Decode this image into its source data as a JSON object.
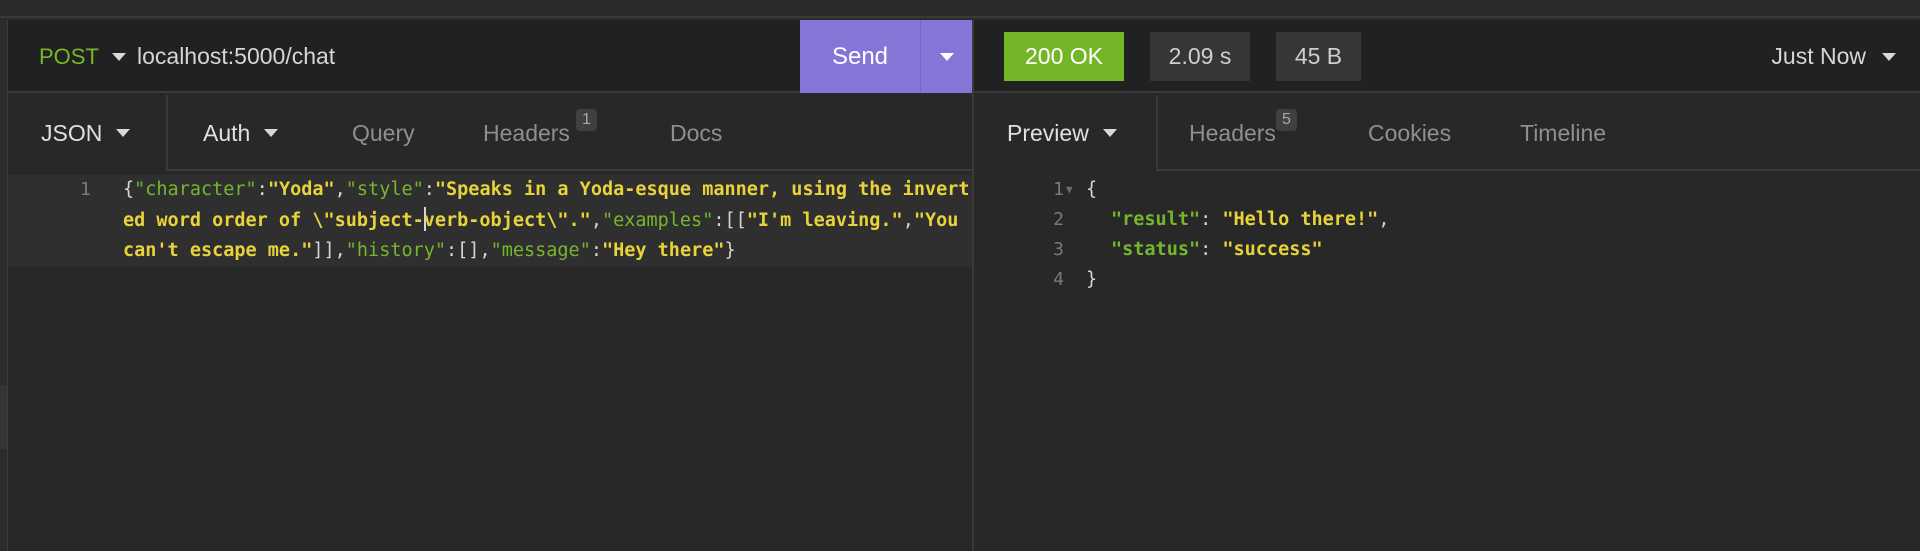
{
  "request": {
    "method": "POST",
    "url": "localhost:5000/chat",
    "send_label": "Send",
    "tabs": [
      {
        "label": "JSON",
        "dropdown": true,
        "active": true
      },
      {
        "label": "Auth",
        "dropdown": true
      },
      {
        "label": "Query"
      },
      {
        "label": "Headers",
        "badge": "1"
      },
      {
        "label": "Docs"
      }
    ],
    "body": {
      "line_number": "1",
      "tokens": {
        "open": "{",
        "k_character": "\"character\"",
        "c1": ":",
        "v_character": "\"Yoda\"",
        "comma1": ",",
        "k_style": "\"style\"",
        "c2": ":",
        "v_style_a": "\"Speaks in a Yoda-esque manner, using the inverted word order of \\\"subject-",
        "v_style_b": "verb-object\\\".\"",
        "comma2": ",",
        "k_examples": "\"examples\"",
        "c3": ":",
        "bracket_open": "[[",
        "v_ex1": "\"I'm leaving.\"",
        "comma3": ",",
        "v_ex2": "\"You can't escape me.\"",
        "bracket_close": "]]",
        "comma4": ",",
        "k_history": "\"history\"",
        "c4": ":",
        "v_history": "[]",
        "comma5": ",",
        "k_message": "\"message\"",
        "c5": ":",
        "v_message": "\"Hey there\"",
        "close": "}"
      }
    }
  },
  "response": {
    "status": "200 OK",
    "time": "2.09 s",
    "size": "45 B",
    "history_label": "Just Now",
    "tabs": [
      {
        "label": "Preview",
        "dropdown": true,
        "active": true
      },
      {
        "label": "Headers",
        "badge": "5"
      },
      {
        "label": "Cookies"
      },
      {
        "label": "Timeline"
      }
    ],
    "lines": [
      {
        "n": "1",
        "open": "{"
      },
      {
        "n": "2",
        "key": "\"result\"",
        "sep": ": ",
        "value": "\"Hello there!\"",
        "trail": ","
      },
      {
        "n": "3",
        "key": "\"status\"",
        "sep": ": ",
        "value": "\"success\"",
        "trail": ""
      },
      {
        "n": "4",
        "close": "}"
      }
    ]
  },
  "colors": {
    "send": "#8674d6",
    "status_ok": "#73b627",
    "method": "#75b72c",
    "json_key": "#75b72c",
    "json_string": "#e8d43a"
  }
}
